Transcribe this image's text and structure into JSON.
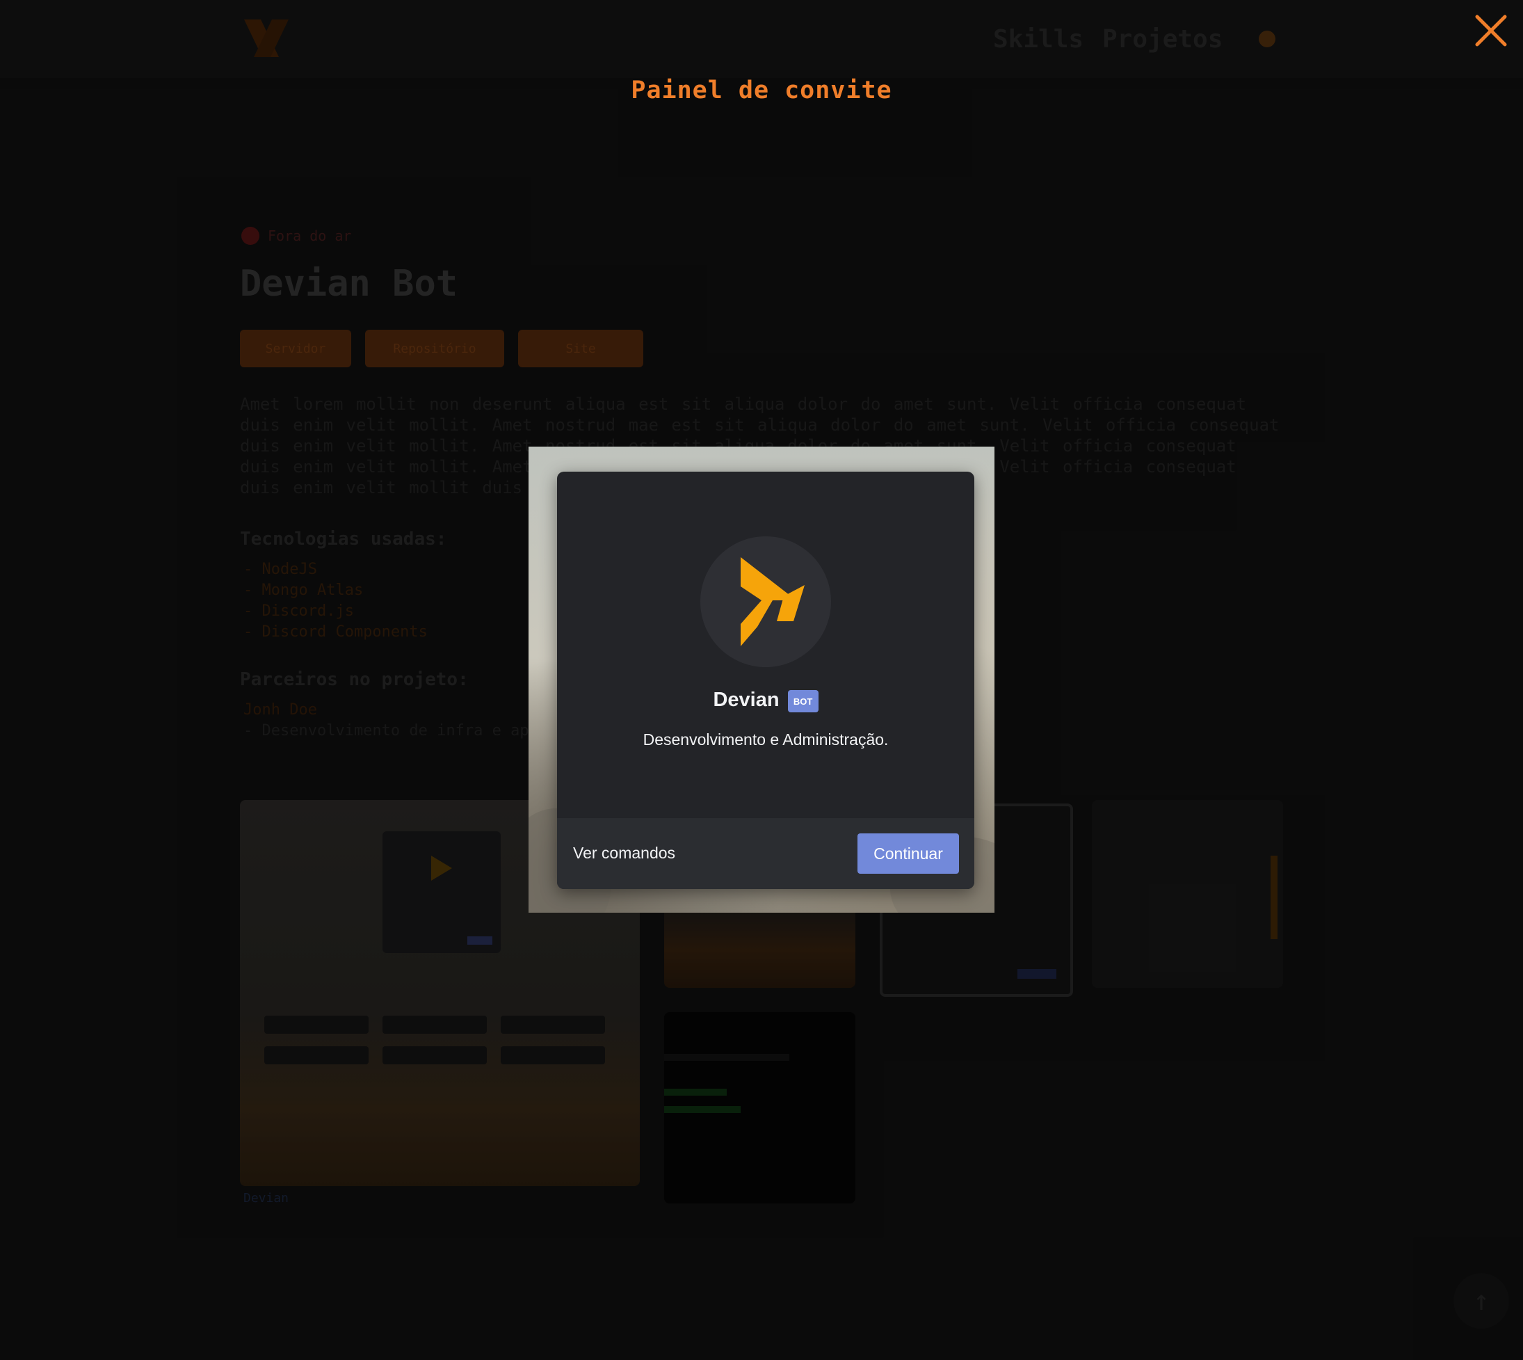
{
  "background": {
    "nav": {
      "skills": "Skills",
      "projects": "Projetos"
    },
    "status": "Fora do ar",
    "title": "Devian Bot",
    "buttons": [
      "Servidor",
      "Repositório",
      "Site"
    ],
    "paragraph": "Amet lorem mollit non deserunt aliqua est sit aliqua dolor do amet sunt. Velit officia consequat duis enim velit mollit. Amet nostrud mae est sit aliqua dolor do amet sunt. Velit officia consequat duis enim velit mollit. Amet nostrud est sit aliqua dolor do amet sunt. Velit officia consequat duis enim velit mollit. Amet nostrud est sit aliqua dolor do amet sunt. Velit officia consequat duis enim velit mollit duis consequat ut.",
    "tech_heading": "Tecnologias usadas:",
    "tech_list": [
      "- NodeJS",
      "- Mongo Atlas",
      "- Discord.js",
      "- Discord Components"
    ],
    "partners_heading": "Parceiros no projeto:",
    "partners_list": [
      "Jonh Doe",
      "- Desenvolvimento de infra e apoio"
    ],
    "footer_row": "Devian"
  },
  "lightbox": {
    "title": "Painel de convite",
    "close_icon": "close-icon",
    "accent_color": "#f07e2a"
  },
  "invite": {
    "bot_name": "Devian",
    "bot_tag": "BOT",
    "description": "Desenvolvimento e Administração.",
    "view_commands": "Ver comandos",
    "continue": "Continuar",
    "avatar_icon": "devian-logo-icon",
    "button_color": "#7289da"
  }
}
